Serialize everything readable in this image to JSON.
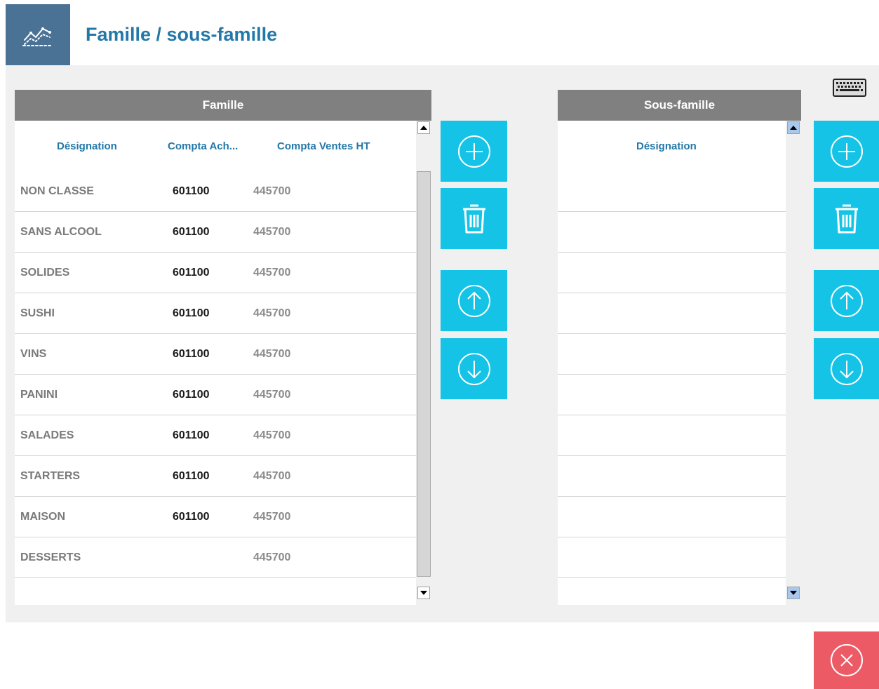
{
  "header": {
    "title": "Famille / sous-famille",
    "logo_icon": "chart-line-icon",
    "logo_color": "#4a7295",
    "title_color": "#2378a8"
  },
  "toolbar": {
    "keyboard_icon": "keyboard-icon"
  },
  "famille": {
    "title": "Famille",
    "columns": [
      "Désignation",
      "Compta Ach...",
      "Compta Ventes HT"
    ],
    "rows": [
      {
        "designation": "NON CLASSE",
        "compta_ach": "601100",
        "compta_ventes": "445700"
      },
      {
        "designation": "SANS ALCOOL",
        "compta_ach": "601100",
        "compta_ventes": "445700"
      },
      {
        "designation": "SOLIDES",
        "compta_ach": "601100",
        "compta_ventes": "445700"
      },
      {
        "designation": "SUSHI",
        "compta_ach": "601100",
        "compta_ventes": "445700"
      },
      {
        "designation": "VINS",
        "compta_ach": "601100",
        "compta_ventes": "445700"
      },
      {
        "designation": "PANINI",
        "compta_ach": "601100",
        "compta_ventes": "445700"
      },
      {
        "designation": "SALADES",
        "compta_ach": "601100",
        "compta_ventes": "445700"
      },
      {
        "designation": "STARTERS",
        "compta_ach": "601100",
        "compta_ventes": "445700"
      },
      {
        "designation": "MAISON",
        "compta_ach": "601100",
        "compta_ventes": "445700"
      },
      {
        "designation": "DESSERTS",
        "compta_ach": "",
        "compta_ventes": "445700"
      }
    ],
    "actions": [
      "plus-circle-icon",
      "trash-icon",
      "arrow-up-circle-icon",
      "arrow-down-circle-icon"
    ]
  },
  "sous_famille": {
    "title": "Sous-famille",
    "columns": [
      "Désignation"
    ],
    "empty_rows": 10,
    "actions": [
      "plus-circle-icon",
      "trash-icon",
      "arrow-up-circle-icon",
      "arrow-down-circle-icon"
    ]
  },
  "footer": {
    "close_icon": "close-circle-icon"
  },
  "colors": {
    "accent": "#14c3e6",
    "danger": "#ec5a65",
    "panel_header": "#808080",
    "column_header_text": "#2378a8"
  }
}
